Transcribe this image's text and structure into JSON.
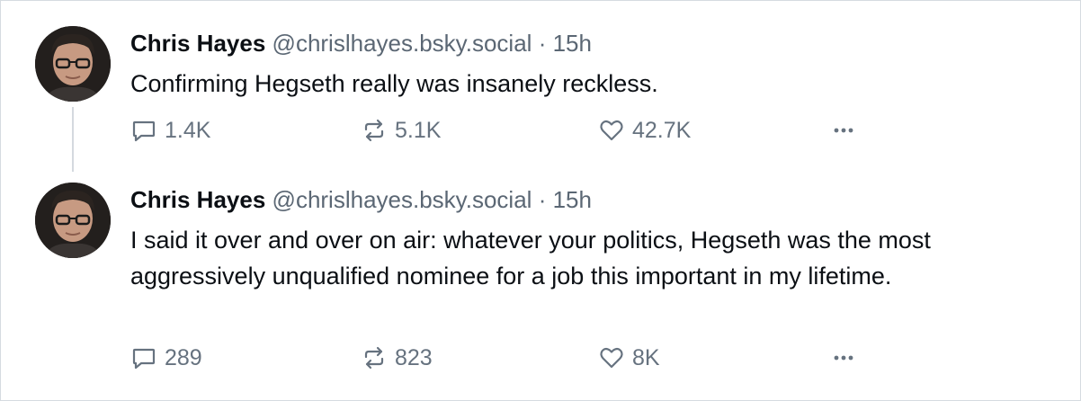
{
  "posts": [
    {
      "author_name": "Chris Hayes",
      "handle": "@chrislhayes.bsky.social",
      "separator": "·",
      "time": "15h",
      "text": "Confirming Hegseth really was insanely reckless.",
      "replies": "1.4K",
      "reposts": "5.1K",
      "likes": "42.7K",
      "more_icon": "ellipsis-icon"
    },
    {
      "author_name": "Chris Hayes",
      "handle": "@chrislhayes.bsky.social",
      "separator": "·",
      "time": "15h",
      "text": "I said it over and over on air: whatever your politics, Hegseth was the most aggressively unqualified nominee for a job this important in my lifetime.",
      "replies": "289",
      "reposts": "823",
      "likes": "8K",
      "more_icon": "ellipsis-icon"
    }
  ],
  "icons": {
    "reply": "speech-bubble-icon",
    "repost": "repost-arrows-icon",
    "like": "heart-icon",
    "more": "ellipsis-icon"
  },
  "colors": {
    "text": "#0b0f14",
    "muted": "#5b6774",
    "border": "#d6dbe0",
    "thread_line": "#d4d9df"
  }
}
